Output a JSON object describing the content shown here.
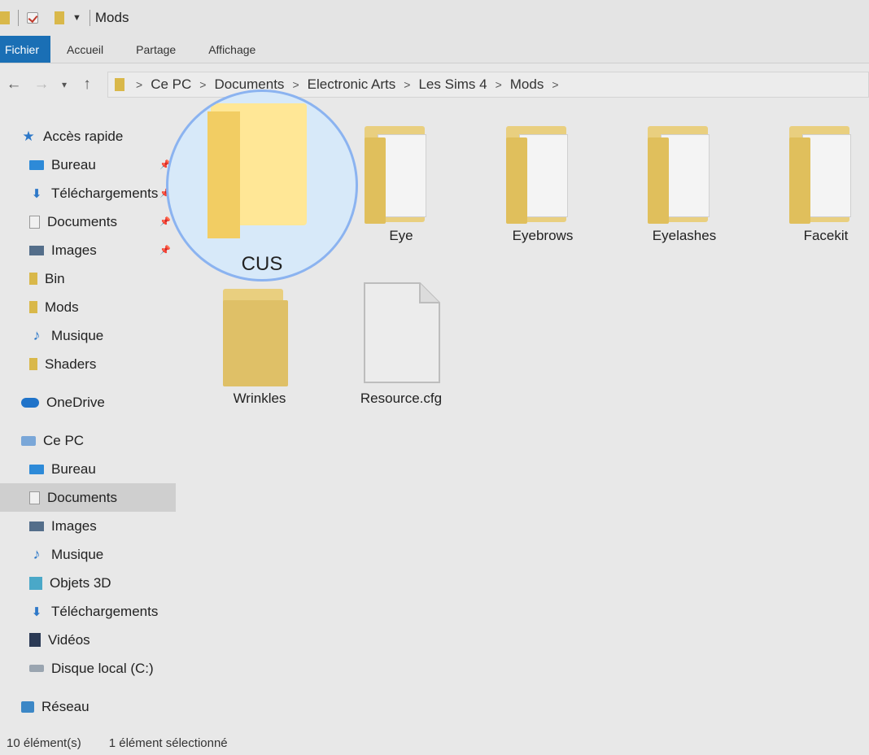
{
  "window": {
    "title": "Mods"
  },
  "ribbon": {
    "tabs": [
      "Fichier",
      "Accueil",
      "Partage",
      "Affichage"
    ]
  },
  "address": {
    "crumbs": [
      "Ce PC",
      "Documents",
      "Electronic Arts",
      "Les Sims 4",
      "Mods"
    ]
  },
  "sidebar": {
    "quick_access": {
      "label": "Accès rapide",
      "items": [
        "Bureau",
        "Téléchargements",
        "Documents",
        "Images",
        "Bin",
        "Mods",
        "Musique",
        "Shaders"
      ]
    },
    "onedrive": "OneDrive",
    "this_pc": {
      "label": "Ce PC",
      "items": [
        "Bureau",
        "Documents",
        "Images",
        "Musique",
        "Objets 3D",
        "Téléchargements",
        "Vidéos",
        "Disque local (C:)"
      ]
    },
    "network": "Réseau",
    "selected": "Documents"
  },
  "content": {
    "items": [
      {
        "name": "CUS",
        "type": "folder"
      },
      {
        "name": "Eye",
        "type": "folder"
      },
      {
        "name": "Eyebrows",
        "type": "folder"
      },
      {
        "name": "Eyelashes",
        "type": "folder"
      },
      {
        "name": "Facekit",
        "type": "folder"
      },
      {
        "name": "Wrinkles",
        "type": "folder"
      },
      {
        "name": "Resource.cfg",
        "type": "file"
      }
    ]
  },
  "status": {
    "count": "10 élément(s)",
    "selection": "1 élément sélectionné"
  },
  "colors": {
    "accent": "#1a6fb5",
    "folder": "#e0bf5c",
    "magnifier_ring": "#8bb3f0"
  }
}
